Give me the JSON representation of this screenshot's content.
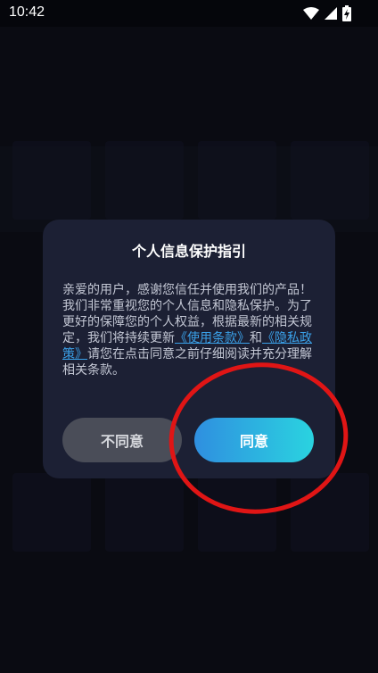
{
  "status_bar": {
    "time": "10:42",
    "icons": [
      "wifi-icon",
      "cell-signal-icon",
      "battery-charging-icon"
    ]
  },
  "dialog": {
    "title": "个人信息保护指引",
    "body_pre": "亲爱的用户，感谢您信任并使用我们的产品！我们非常重视您的个人信息和隐私保护。为了更好的保障您的个人权益，根据最新的相关规定，我们将持续更新",
    "terms_link": "《使用条款》",
    "and": "和",
    "privacy_link": "《隐私政策》",
    "body_post": "请您在点击同意之前仔细阅读并充分理解相关条款。",
    "disagree_label": "不同意",
    "agree_label": "同意"
  },
  "colors": {
    "dialog_bg": "#1c2034",
    "link": "#3aa0e8",
    "agree_gradient_start": "#2f8fe0",
    "agree_gradient_end": "#2ad3e0",
    "disagree_bg": "#4a4d58",
    "annotation_circle": "#e01515"
  }
}
